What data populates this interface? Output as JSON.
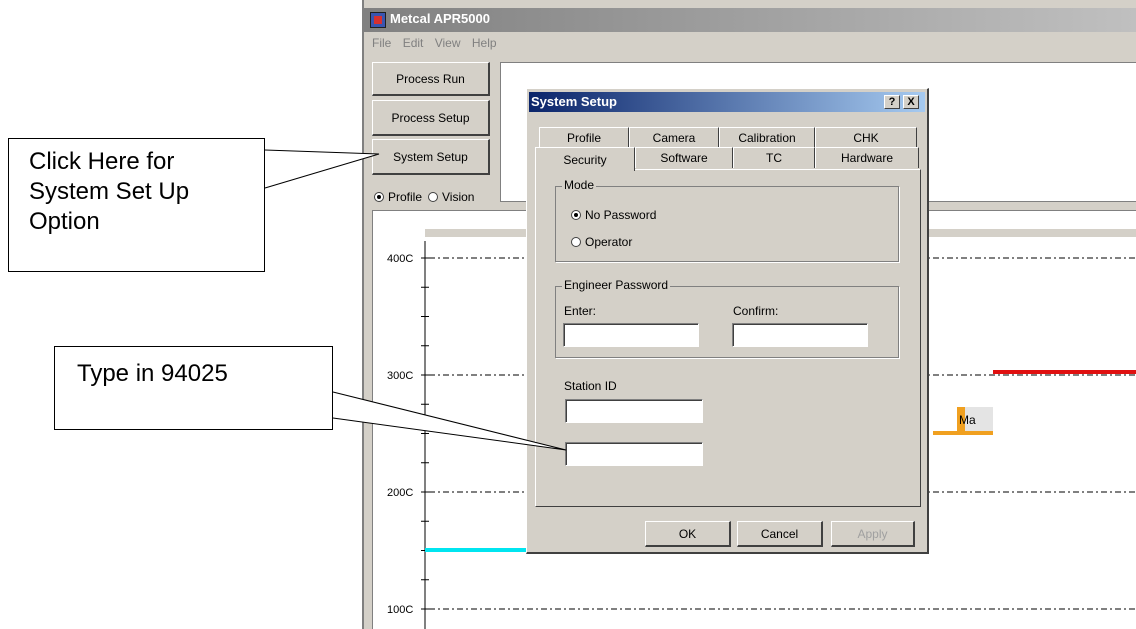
{
  "app": {
    "title": "Metcal APR5000",
    "menu": [
      "File",
      "Edit",
      "View",
      "Help"
    ],
    "buttons": {
      "process_run": "Process Run",
      "process_setup": "Process Setup",
      "system_setup": "System Setup"
    },
    "view_mode": {
      "profile": "Profile",
      "vision": "Vision",
      "selected": "Profile"
    }
  },
  "chart_data": {
    "type": "line",
    "y_ticks": [
      "400C",
      "300C",
      "200C",
      "100C"
    ],
    "ylim": [
      100,
      400
    ],
    "grid": true,
    "annotations": [
      "Ma"
    ],
    "colors": {
      "cyan_line": "#00e5f0",
      "red_line": "#e01010",
      "orange_line": "#f0a020",
      "top_band": "#d4d0c8"
    }
  },
  "dialog": {
    "title": "System Setup",
    "help_button": "?",
    "close_button": "X",
    "tabs_row1": [
      "Profile",
      "Camera",
      "Calibration",
      "CHK"
    ],
    "tabs_row2": [
      "Security",
      "Software",
      "TC",
      "Hardware"
    ],
    "active_tab": "Security",
    "mode_group": {
      "label": "Mode",
      "options": [
        "No Password",
        "Operator"
      ],
      "selected": "No Password"
    },
    "engineer_password_group": {
      "label": "Engineer Password",
      "enter_label": "Enter:",
      "confirm_label": "Confirm:",
      "enter_value": "",
      "confirm_value": ""
    },
    "station_id": {
      "label": "Station ID",
      "value": ""
    },
    "extra_field_value": "",
    "buttons": {
      "ok": "OK",
      "cancel": "Cancel",
      "apply": "Apply"
    }
  },
  "callouts": {
    "system_setup": "Click Here for System Set Up Option",
    "type_in": "Type in 94025"
  }
}
